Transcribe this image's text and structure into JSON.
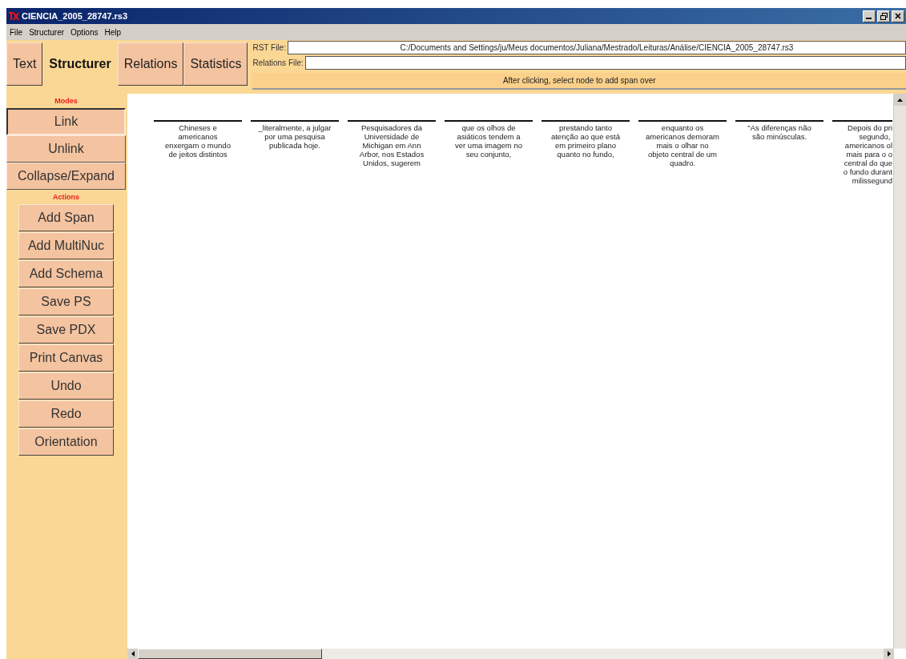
{
  "window": {
    "title": "CIENCIA_2005_28747.rs3"
  },
  "menu": [
    "File",
    "Structurer",
    "Options",
    "Help"
  ],
  "tabs": [
    {
      "label": "Text",
      "selected": false
    },
    {
      "label": "Structurer",
      "selected": true
    },
    {
      "label": "Relations",
      "selected": false
    },
    {
      "label": "Statistics",
      "selected": false
    }
  ],
  "rst_file": {
    "label": "RST File:",
    "value": "C:/Documents and Settings/ju/Meus documentos/Juliana/Mestrado/Leituras/Análise/CIENCIA_2005_28747.rs3"
  },
  "relations_file": {
    "label": "Relations File:"
  },
  "status": "After clicking, select node to add span over",
  "modes": {
    "label": "Modes",
    "buttons": [
      {
        "label": "Link",
        "selected": true
      },
      {
        "label": "Unlink",
        "selected": false
      },
      {
        "label": "Collapse/Expand",
        "selected": false
      }
    ]
  },
  "actions": {
    "label": "Actions",
    "buttons": [
      "Add Span",
      "Add MultiNuc",
      "Add Schema",
      "Save PS",
      "Save PDX",
      "Print Canvas",
      "Undo",
      "Redo",
      "Orientation"
    ]
  },
  "nodes": [
    {
      "text": "Chineses e\namericanos\nenxergam o mundo\nde jeitos distintos"
    },
    {
      "text": "_literalmente, a julgar\npor uma pesquisa\npublicada hoje."
    },
    {
      "text": "Pesquisadores da\nUniversidade de\nMichigan em Ann\nArbor, nos Estados\nUnidos, sugerem"
    },
    {
      "text": "que os olhos de\nasiáticos tendem a\nver uma imagem no\nseu conjunto,"
    },
    {
      "text": "prestando tanto\natenção ao que está\nem primeiro plano\nquanto no fundo,"
    },
    {
      "text": "enquanto os\namericanos demoram\nmais o olhar no\nobjeto central de um\nquadro."
    },
    {
      "text": "\"As diferenças não\nsão minúsculas."
    },
    {
      "text": "Depois do pri\nsegundo, \namericanos ol\nmais para o o\ncentral do que\no fundo durant\nmilissegund",
      "cut": true
    }
  ]
}
